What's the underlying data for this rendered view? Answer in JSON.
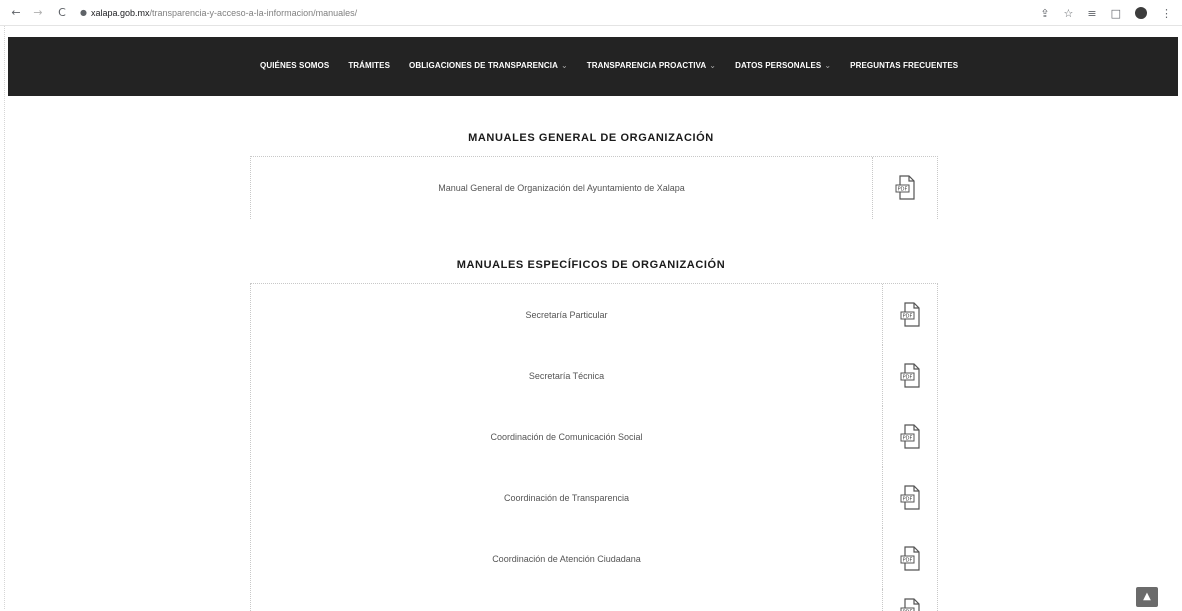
{
  "browser": {
    "back_icon": "←",
    "forward_icon": "→",
    "reload_icon": "C",
    "lock_icon": "🔒",
    "url_host": "xalapa.gob.mx",
    "url_path": "/transparencia-y-acceso-a-la-informacion/manuales/",
    "share_icon": "⇪",
    "star_icon": "☆",
    "queue_icon": "≡",
    "window_icon": "□",
    "menu_icon": "⋮"
  },
  "nav": {
    "items": [
      {
        "label": "QUIÉNES SOMOS",
        "dropdown": false
      },
      {
        "label": "TRÁMITES",
        "dropdown": false
      },
      {
        "label": "OBLIGACIONES DE TRANSPARENCIA",
        "dropdown": true
      },
      {
        "label": "TRANSPARENCIA PROACTIVA",
        "dropdown": true
      },
      {
        "label": "DATOS PERSONALES",
        "dropdown": true
      },
      {
        "label": "PREGUNTAS FRECUENTES",
        "dropdown": false
      }
    ],
    "caret": "⌄"
  },
  "sections": [
    {
      "title": "MANUALES GENERAL DE ORGANIZACIÓN",
      "rows": [
        {
          "label": "Manual General de Organización del Ayuntamiento de Xalapa",
          "icon": "pdf-icon"
        }
      ]
    },
    {
      "title": "MANUALES ESPECÍFICOS DE ORGANIZACIÓN",
      "rows": [
        {
          "label": "Secretaría Particular",
          "icon": "pdf-icon"
        },
        {
          "label": "Secretaría Técnica",
          "icon": "pdf-icon"
        },
        {
          "label": "Coordinación de Comunicación Social",
          "icon": "pdf-icon"
        },
        {
          "label": "Coordinación de Transparencia",
          "icon": "pdf-icon"
        },
        {
          "label": "Coordinación de Atención Ciudadana",
          "icon": "pdf-icon"
        },
        {
          "label": "",
          "icon": "pdf-icon"
        }
      ]
    }
  ],
  "back_to_top_icon": "▲"
}
